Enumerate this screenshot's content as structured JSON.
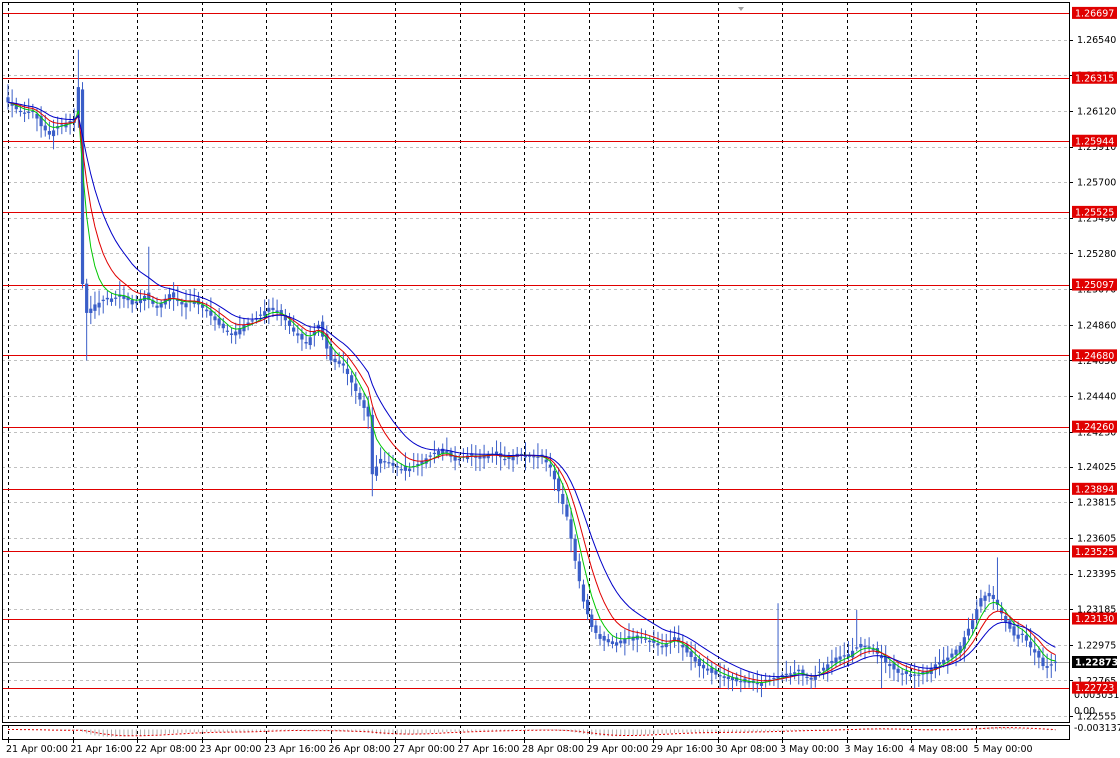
{
  "chart_data": {
    "type": "candlestick",
    "title": "",
    "grid": true,
    "colors": {
      "background": "#ffffff",
      "frame": "#000000",
      "grid": "#c0c0c0",
      "candle": "#3a5ec8",
      "levels": "#e00000",
      "ma_fast": "#00c800",
      "ma_mid": "#e00000",
      "ma_slow": "#0000c8",
      "osc_hist": "#b0b0b0",
      "osc_signal": "#e00000",
      "current_price_tag": "#000000"
    },
    "price_axis": {
      "min": 1.2255,
      "max": 1.2672,
      "ticks": [
        "1.26540",
        "1.26330",
        "1.26120",
        "1.25910",
        "1.25700",
        "1.25490",
        "1.25280",
        "1.25070",
        "1.24860",
        "1.24650",
        "1.24440",
        "1.24230",
        "1.24025",
        "1.23815",
        "1.23605",
        "1.23395",
        "1.23185",
        "1.22975",
        "1.22765",
        "1.22555"
      ]
    },
    "time_axis": {
      "labels": [
        "21 Apr 00:00",
        "21 Apr 16:00",
        "22 Apr 08:00",
        "23 Apr 00:00",
        "23 Apr 16:00",
        "26 Apr 08:00",
        "27 Apr 00:00",
        "27 Apr 16:00",
        "28 Apr 08:00",
        "29 Apr 00:00",
        "29 Apr 16:00",
        "30 Apr 08:00",
        "3 May 00:00",
        "3 May 16:00",
        "4 May 08:00",
        "5 May 00:00"
      ]
    },
    "horizontal_levels": [
      "1.26697",
      "1.26315",
      "1.25944",
      "1.25525",
      "1.25097",
      "1.24680",
      "1.24260",
      "1.23894",
      "1.23525",
      "1.23130",
      "1.22723"
    ],
    "current_price": "1.22873",
    "price_anchors": [
      [
        0,
        1.2617
      ],
      [
        2,
        1.2613
      ],
      [
        4,
        1.2611
      ],
      [
        6,
        1.2612
      ],
      [
        8,
        1.2603
      ],
      [
        10,
        1.2598
      ],
      [
        12,
        1.2603
      ],
      [
        14,
        1.2605
      ],
      [
        16,
        1.2607
      ],
      [
        17,
        1.2626
      ],
      [
        18,
        1.251
      ],
      [
        19,
        1.2493
      ],
      [
        21,
        1.2498
      ],
      [
        24,
        1.2501
      ],
      [
        28,
        1.2503
      ],
      [
        30,
        1.2498
      ],
      [
        33,
        1.2503
      ],
      [
        36,
        1.2496
      ],
      [
        39,
        1.2504
      ],
      [
        42,
        1.2498
      ],
      [
        45,
        1.25
      ],
      [
        48,
        1.2494
      ],
      [
        51,
        1.2486
      ],
      [
        54,
        1.248
      ],
      [
        57,
        1.2486
      ],
      [
        60,
        1.249
      ],
      [
        63,
        1.2496
      ],
      [
        66,
        1.2492
      ],
      [
        69,
        1.2482
      ],
      [
        72,
        1.2475
      ],
      [
        75,
        1.2486
      ],
      [
        78,
        1.2465
      ],
      [
        81,
        1.2462
      ],
      [
        84,
        1.2447
      ],
      [
        87,
        1.2432
      ],
      [
        88,
        1.2398
      ],
      [
        90,
        1.2407
      ],
      [
        93,
        1.2403
      ],
      [
        96,
        1.24
      ],
      [
        99,
        1.2404
      ],
      [
        102,
        1.2409
      ],
      [
        105,
        1.2413
      ],
      [
        108,
        1.2406
      ],
      [
        111,
        1.2409
      ],
      [
        114,
        1.2409
      ],
      [
        117,
        1.241
      ],
      [
        120,
        1.2407
      ],
      [
        123,
        1.241
      ],
      [
        126,
        1.2409
      ],
      [
        129,
        1.2408
      ],
      [
        131,
        1.2402
      ],
      [
        133,
        1.2388
      ],
      [
        135,
        1.2373
      ],
      [
        137,
        1.2347
      ],
      [
        139,
        1.2323
      ],
      [
        141,
        1.2308
      ],
      [
        143,
        1.2301
      ],
      [
        146,
        1.2298
      ],
      [
        149,
        1.2301
      ],
      [
        152,
        1.2303
      ],
      [
        155,
        1.23
      ],
      [
        158,
        1.2296
      ],
      [
        161,
        1.2302
      ],
      [
        164,
        1.2293
      ],
      [
        167,
        1.2285
      ],
      [
        170,
        1.2281
      ],
      [
        173,
        1.2278
      ],
      [
        176,
        1.2276
      ],
      [
        179,
        1.2275
      ],
      [
        182,
        1.2275
      ],
      [
        185,
        1.2278
      ],
      [
        188,
        1.228
      ],
      [
        191,
        1.2282
      ],
      [
        194,
        1.2277
      ],
      [
        197,
        1.2284
      ],
      [
        200,
        1.229
      ],
      [
        203,
        1.2292
      ],
      [
        206,
        1.2298
      ],
      [
        209,
        1.2295
      ],
      [
        212,
        1.2287
      ],
      [
        215,
        1.2281
      ],
      [
        218,
        1.228
      ],
      [
        221,
        1.228
      ],
      [
        224,
        1.2286
      ],
      [
        227,
        1.229
      ],
      [
        230,
        1.2297
      ],
      [
        233,
        1.2312
      ],
      [
        235,
        1.2325
      ],
      [
        237,
        1.2328
      ],
      [
        239,
        1.2321
      ],
      [
        241,
        1.2311
      ],
      [
        243,
        1.2303
      ],
      [
        245,
        1.2304
      ],
      [
        247,
        1.2296
      ],
      [
        249,
        1.229
      ],
      [
        250,
        1.2285
      ],
      [
        251,
        1.2285
      ],
      [
        253,
        1.2287
      ]
    ]
  }
}
